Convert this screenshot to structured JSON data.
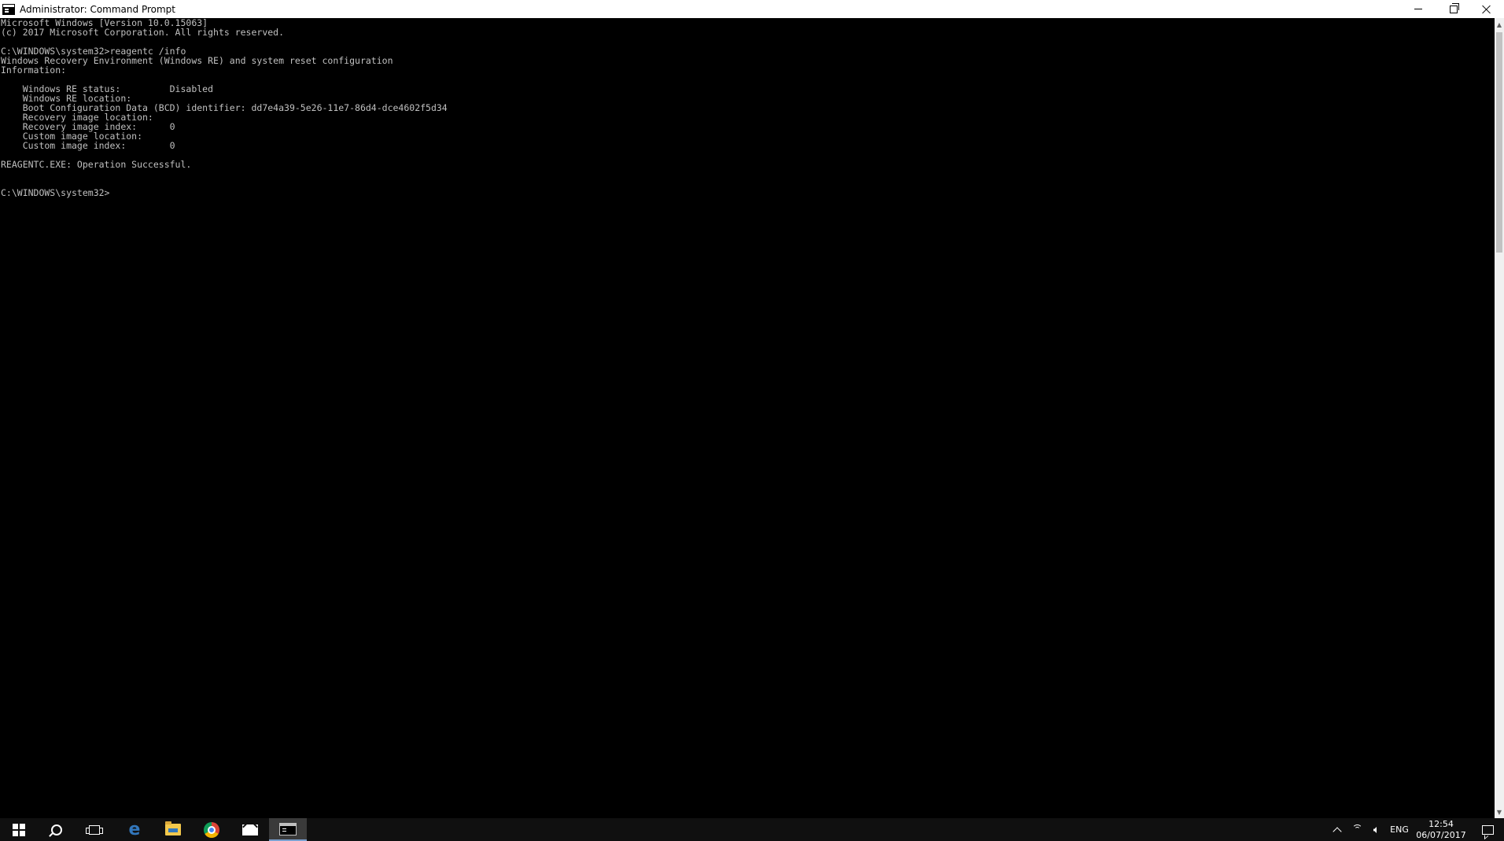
{
  "window": {
    "title": "Administrator: Command Prompt",
    "controls": {
      "minimize": "minimize-icon",
      "maximize": "restore-icon",
      "close": "close-icon"
    }
  },
  "console": {
    "background": "#000000",
    "foreground": "#c0c0c0",
    "lines": [
      "Microsoft Windows [Version 10.0.15063]",
      "(c) 2017 Microsoft Corporation. All rights reserved.",
      "",
      "C:\\WINDOWS\\system32>reagentc /info",
      "Windows Recovery Environment (Windows RE) and system reset configuration",
      "Information:",
      "",
      "    Windows RE status:         Disabled",
      "    Windows RE location:",
      "    Boot Configuration Data (BCD) identifier: dd7e4a39-5e26-11e7-86d4-dce4602f5d34",
      "    Recovery image location:",
      "    Recovery image index:      0",
      "    Custom image location:",
      "    Custom image index:        0",
      "",
      "REAGENTC.EXE: Operation Successful.",
      "",
      "",
      "C:\\WINDOWS\\system32>"
    ]
  },
  "taskbar": {
    "background": "#101010",
    "pinned": [
      {
        "name": "start",
        "icon": "windows-logo-icon"
      },
      {
        "name": "search",
        "icon": "search-icon"
      },
      {
        "name": "task-view",
        "icon": "task-view-icon"
      },
      {
        "name": "edge",
        "icon": "edge-icon",
        "glyph": "e"
      },
      {
        "name": "file-explorer",
        "icon": "folder-icon"
      },
      {
        "name": "chrome",
        "icon": "chrome-icon"
      },
      {
        "name": "mail",
        "icon": "mail-icon"
      },
      {
        "name": "command-prompt",
        "icon": "command-prompt-icon",
        "active": true
      }
    ],
    "tray": {
      "language": "ENG",
      "time": "12:54",
      "date": "06/07/2017"
    }
  }
}
